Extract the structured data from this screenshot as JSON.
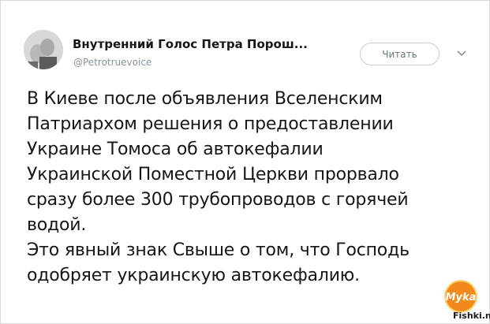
{
  "tweet": {
    "display_name": "Внутренний Голос Петра Порош...",
    "handle": "@Petrotruevoice",
    "follow_label": "Читать",
    "lines": [
      "В Киеве после объявления Вселенским",
      "Патриархом решения о предоставлении",
      "Украине Томоса об автокефалии",
      "Украинской Поместной Церкви прорвало",
      "сразу более 300 трубопроводов с горячей",
      "водой.",
      "Это явный знак Свыше о том, что Господь",
      "одобряет украинскую автокефалию."
    ]
  },
  "icons": {
    "avatar": "avatar-photo",
    "menu": "chevron-down-icon",
    "watermark": "fishki-logo"
  },
  "watermark": {
    "text": "Fishki.net",
    "logo_text": "Myka"
  },
  "colors": {
    "text": "#14171a",
    "secondary": "#8a939b",
    "button_border": "#c5ccd3",
    "watermark_orange": "#f08a1d"
  }
}
